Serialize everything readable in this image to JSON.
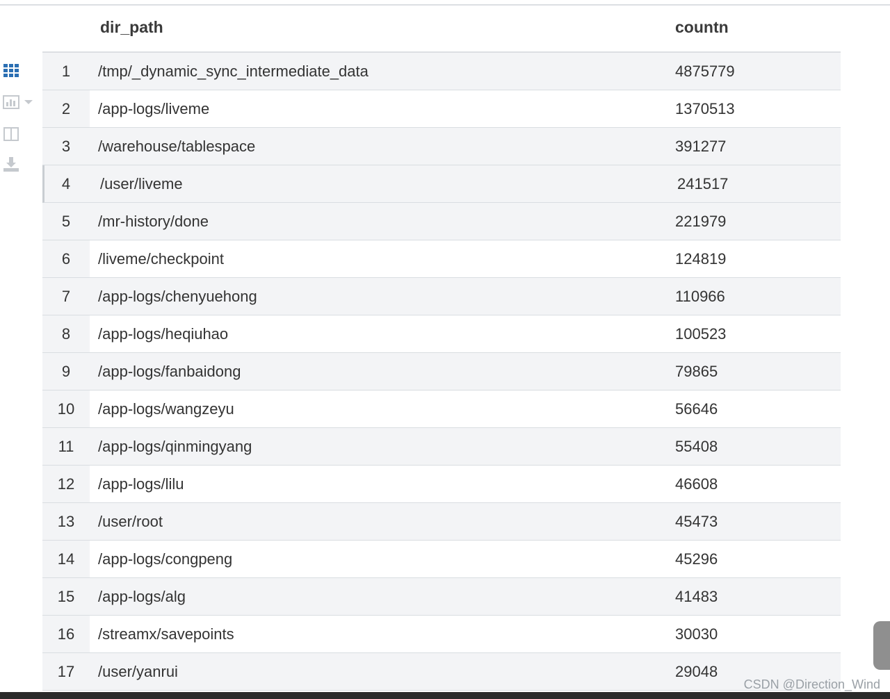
{
  "table": {
    "columns": {
      "path": "dir_path",
      "count": "countn"
    },
    "rows": [
      {
        "index": "1",
        "dir_path": "/tmp/_dynamic_sync_intermediate_data",
        "countn": "4875779"
      },
      {
        "index": "2",
        "dir_path": "/app-logs/liveme",
        "countn": "1370513"
      },
      {
        "index": "3",
        "dir_path": "/warehouse/tablespace",
        "countn": "391277"
      },
      {
        "index": "4",
        "dir_path": "/user/liveme",
        "countn": "241517"
      },
      {
        "index": "5",
        "dir_path": "/mr-history/done",
        "countn": "221979"
      },
      {
        "index": "6",
        "dir_path": "/liveme/checkpoint",
        "countn": "124819"
      },
      {
        "index": "7",
        "dir_path": "/app-logs/chenyuehong",
        "countn": "110966"
      },
      {
        "index": "8",
        "dir_path": "/app-logs/heqiuhao",
        "countn": "100523"
      },
      {
        "index": "9",
        "dir_path": "/app-logs/fanbaidong",
        "countn": "79865"
      },
      {
        "index": "10",
        "dir_path": "/app-logs/wangzeyu",
        "countn": "56646"
      },
      {
        "index": "11",
        "dir_path": "/app-logs/qinmingyang",
        "countn": "55408"
      },
      {
        "index": "12",
        "dir_path": "/app-logs/lilu",
        "countn": "46608"
      },
      {
        "index": "13",
        "dir_path": "/user/root",
        "countn": "45473"
      },
      {
        "index": "14",
        "dir_path": "/app-logs/congpeng",
        "countn": "45296"
      },
      {
        "index": "15",
        "dir_path": "/app-logs/alg",
        "countn": "41483"
      },
      {
        "index": "16",
        "dir_path": "/streamx/savepoints",
        "countn": "30030"
      },
      {
        "index": "17",
        "dir_path": "/user/yanrui",
        "countn": "29048"
      }
    ]
  },
  "toolbar": {
    "icons": [
      "grid-view-icon",
      "bar-chart-icon",
      "chevron-down-icon",
      "split-column-icon",
      "download-icon"
    ],
    "accent_color": "#2b6fb3",
    "inactive_color": "#c5c9ce"
  },
  "watermark": "CSDN @Direction_Wind"
}
